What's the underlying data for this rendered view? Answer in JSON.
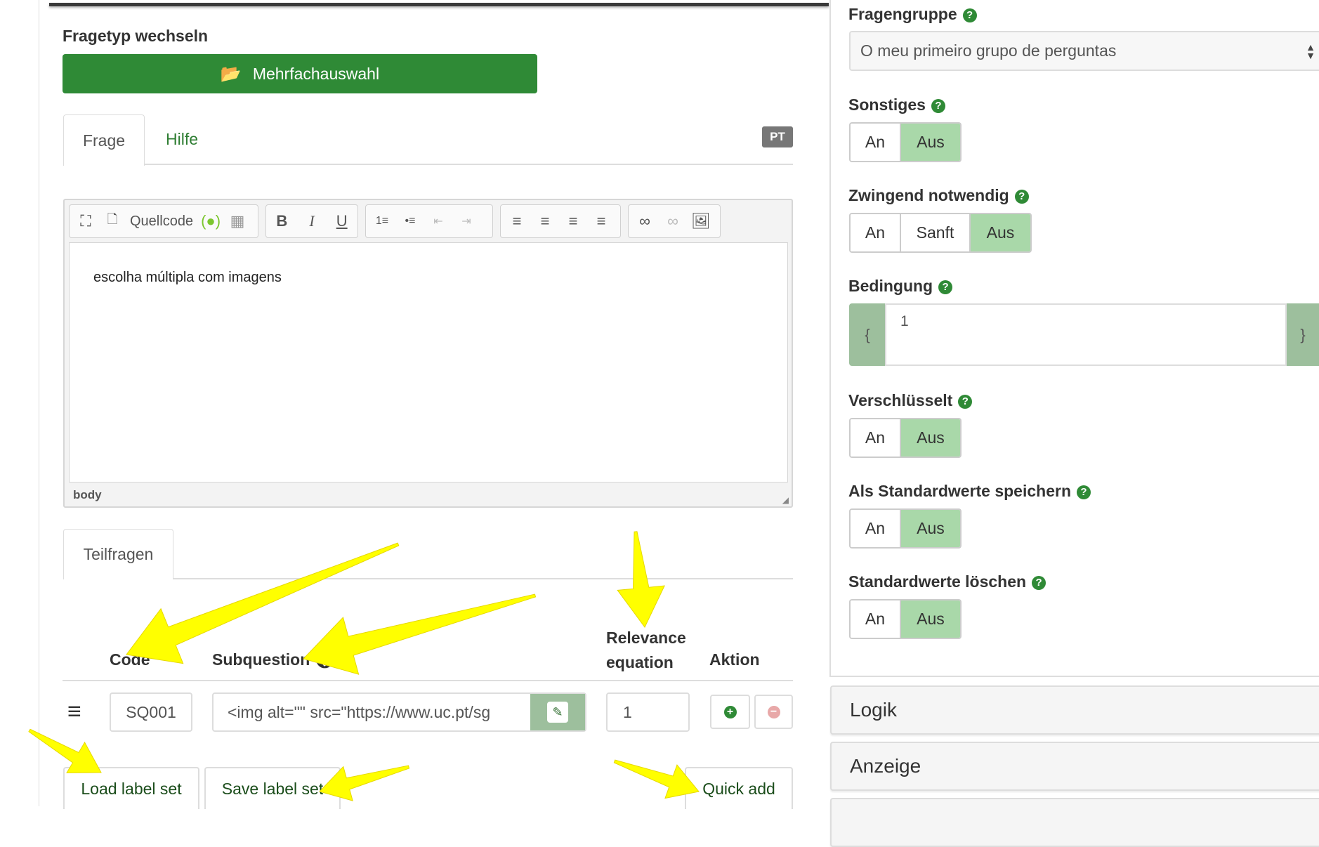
{
  "left": {
    "change_type_label": "Fragetyp wechseln",
    "type_button": "Mehrfachauswahl",
    "tabs": [
      {
        "label": "Frage"
      },
      {
        "label": "Hilfe"
      }
    ],
    "lang_badge": "PT",
    "toolbar": {
      "source_label": "Quellcode"
    },
    "editor_text": "escolha múltipla com imagens",
    "status_path": "body",
    "subq_tab": "Teilfragen",
    "columns": {
      "code": "Code",
      "subquestion": "Subquestion",
      "relevance_1": "Relevance",
      "relevance_2": "equation",
      "action": "Aktion"
    },
    "rows": [
      {
        "code": "SQ001",
        "subquestion": "<img alt=\"\" src=\"https://www.uc.pt/sg",
        "relevance": "1"
      }
    ],
    "buttons": {
      "load": "Load label set",
      "save": "Save label set",
      "quick_add": "Quick add"
    }
  },
  "right": {
    "group_label": "Fragengruppe",
    "group_value": "O meu primeiro grupo de perguntas",
    "other_label": "Sonstiges",
    "mandatory_label": "Zwingend notwendig",
    "condition_label": "Bedingung",
    "condition_value": "1",
    "condition_open": "{",
    "condition_close": "}",
    "encrypted_label": "Verschlüsselt",
    "save_default_label": "Als Standardwerte speichern",
    "clear_default_label": "Standardwerte löschen",
    "on": "An",
    "off": "Aus",
    "soft": "Sanft",
    "help": "?",
    "panels": [
      "Logik",
      "Anzeige"
    ]
  },
  "colors": {
    "accent": "#2f8a36",
    "toggle_active": "#a9d8a9",
    "annotation": "#ffff00"
  }
}
